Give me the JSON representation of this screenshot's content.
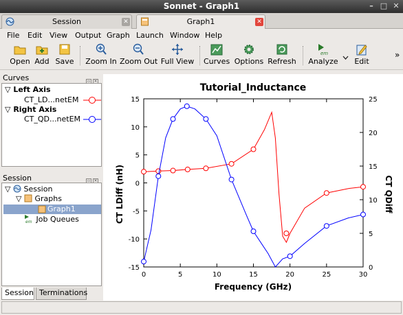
{
  "window": {
    "title": "Sonnet - Graph1"
  },
  "tabs": [
    {
      "label": "Session",
      "active": false
    },
    {
      "label": "Graph1",
      "active": true
    }
  ],
  "menu": [
    "File",
    "Edit",
    "View",
    "Output",
    "Graph",
    "Launch",
    "Window",
    "Help"
  ],
  "toolbar": {
    "open": "Open",
    "add": "Add",
    "save": "Save",
    "zoom_in": "Zoom In",
    "zoom_out": "Zoom Out",
    "full_view": "Full View",
    "curves": "Curves",
    "options": "Options",
    "refresh": "Refresh",
    "analyze": "Analyze",
    "edit": "Edit",
    "overflow": "»"
  },
  "curves_panel": {
    "title": "Curves",
    "left_axis": "Left Axis",
    "left_item": "CT_LD...netEM",
    "right_axis": "Right Axis",
    "right_item": "CT_QD...netEM"
  },
  "session_panel": {
    "title": "Session",
    "root": "Session",
    "graphs": "Graphs",
    "graph1": "Graph1",
    "job_queues": "Job Queues"
  },
  "bottom_tabs": [
    "Session",
    "Terminations"
  ],
  "colors": {
    "red": "#ff0000",
    "blue": "#0000ff",
    "selection": "#8aa4cc"
  },
  "chart_data": {
    "type": "line",
    "title": "Tutorial_Inductance",
    "xlabel": "Frequency (GHz)",
    "ylabel": "CT LDiff (nH)",
    "y2label": "CT QDiff",
    "xlim": [
      0,
      30
    ],
    "ylim": [
      -15,
      15
    ],
    "y2lim": [
      0,
      25
    ],
    "xticks": [
      0,
      5,
      10,
      15,
      20,
      25,
      30
    ],
    "yticks": [
      -15,
      -10,
      -5,
      0,
      5,
      10,
      15
    ],
    "y2ticks": [
      0,
      5,
      10,
      15,
      20,
      25
    ],
    "series": [
      {
        "axis": "left",
        "color": "#ff0000",
        "x": [
          0,
          2.0,
          4.0,
          6.0,
          8.5,
          12.0,
          15.0,
          16.5,
          17.5,
          18.0,
          18.5,
          19.0,
          19.5,
          20.0,
          22.0,
          25.0,
          28.0,
          30.0
        ],
        "y": [
          2.0,
          2.1,
          2.2,
          2.4,
          2.6,
          3.4,
          6.0,
          9.5,
          12.6,
          8.0,
          -2.0,
          -9.5,
          -10.6,
          -9.0,
          -4.5,
          -1.8,
          -1.0,
          -0.7
        ],
        "markers_x": [
          0,
          2,
          4,
          6,
          8.5,
          12,
          15,
          19.5,
          25,
          30
        ],
        "markers_y": [
          2.0,
          2.1,
          2.2,
          2.4,
          2.6,
          3.4,
          6.0,
          -9.0,
          -1.8,
          -0.7
        ]
      },
      {
        "axis": "right",
        "color": "#0000ff",
        "x": [
          0,
          1.0,
          2.0,
          3.0,
          4.0,
          5.0,
          5.9,
          7.0,
          8.5,
          10.0,
          12.0,
          14.0,
          15.0,
          17.0,
          18.0,
          19.0,
          20.0,
          22.0,
          25.0,
          28.0,
          30.0
        ],
        "y": [
          0.8,
          5.5,
          13.5,
          19.2,
          22.0,
          23.5,
          23.9,
          23.5,
          22.0,
          19.5,
          13.0,
          7.8,
          5.3,
          2.0,
          0.0,
          1.2,
          1.6,
          3.5,
          6.1,
          7.3,
          7.8
        ],
        "markers_x": [
          0,
          2,
          4,
          5.9,
          8.5,
          12,
          15,
          20,
          25,
          30
        ],
        "markers_y": [
          0.8,
          13.5,
          22.0,
          23.9,
          22.0,
          13.0,
          5.3,
          1.6,
          6.1,
          7.8
        ]
      }
    ]
  }
}
